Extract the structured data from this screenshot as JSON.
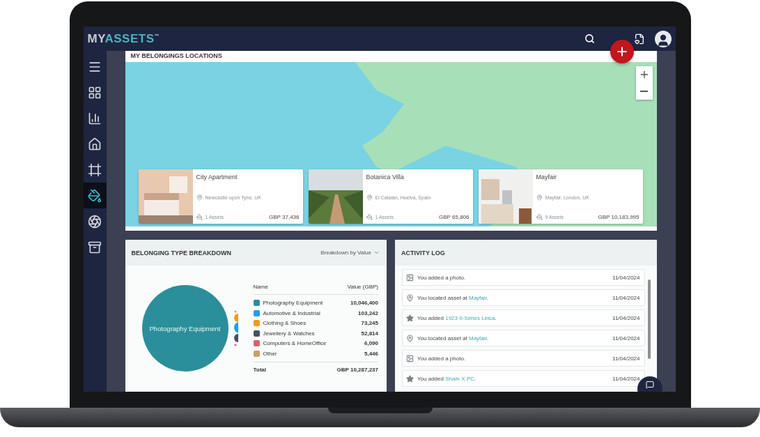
{
  "app": {
    "logo_prefix": "MY",
    "logo_main": "ASSETS",
    "logo_mark": "™"
  },
  "sidebar": {
    "items": [
      {
        "selected": false
      },
      {
        "selected": false
      },
      {
        "selected": false
      },
      {
        "selected": false
      },
      {
        "selected": false
      },
      {
        "selected": true
      },
      {
        "selected": false
      },
      {
        "selected": false
      }
    ]
  },
  "map_card": {
    "title": "MY BELONGINGS LOCATIONS",
    "locations": [
      {
        "name": "City Apartment",
        "address": "Newcastle upon Tyne, UK",
        "assets": "1 Assets",
        "value": "GBP 37,436"
      },
      {
        "name": "Botanica Villa",
        "address": "El Catalán, Huelva, Spain",
        "assets": "1 Assets",
        "value": "GBP 65,806"
      },
      {
        "name": "Mayfair",
        "address": "Mayfair, London, UK",
        "assets": "9 Assets",
        "value": "GBP 10,183,995"
      }
    ]
  },
  "breakdown": {
    "title": "BELONGING TYPE BREAKDOWN",
    "dropdown": "Breakdown by Value",
    "bubble_label": "Photography Equipment",
    "columns": [
      "Name",
      "Value (GBP)"
    ],
    "rows": [
      {
        "name": "Photography Equipment",
        "value": "10,046,400",
        "color": "#2a8f9a"
      },
      {
        "name": "Automotive & Industrial",
        "value": "103,242",
        "color": "#1ea0f0"
      },
      {
        "name": "Clothing & Shoes",
        "value": "73,245",
        "color": "#f39a1e"
      },
      {
        "name": "Jewellery & Watches",
        "value": "52,814",
        "color": "#4a5060"
      },
      {
        "name": "Computers & HomeOffice",
        "value": "6,090",
        "color": "#d9626e"
      },
      {
        "name": "Other",
        "value": "5,446",
        "color": "#c9a06a"
      }
    ],
    "total": {
      "label": "Total",
      "value": "GBP 10,287,237"
    }
  },
  "activity_log": {
    "title": "ACTIVITY LOG",
    "entries": [
      {
        "text": "You added a photo.",
        "date": "11/04/2024"
      },
      {
        "kind": "location",
        "text": "You located asset at ",
        "link": "Mayfair",
        "after": ".",
        "date": "11/04/2024"
      },
      {
        "kind": "asset",
        "text": "You added ",
        "link": "1923 0-Series Leica",
        "after": ".",
        "date": "11/04/2024"
      },
      {
        "kind": "location",
        "text": "You located asset at ",
        "link": "Mayfair",
        "after": ".",
        "date": "11/04/2024"
      },
      {
        "text": "You added a photo.",
        "date": "11/04/2024"
      },
      {
        "kind": "asset",
        "text": "You added ",
        "link": "Shark X PC",
        "after": ".",
        "date": "11/04/2024"
      }
    ]
  }
}
